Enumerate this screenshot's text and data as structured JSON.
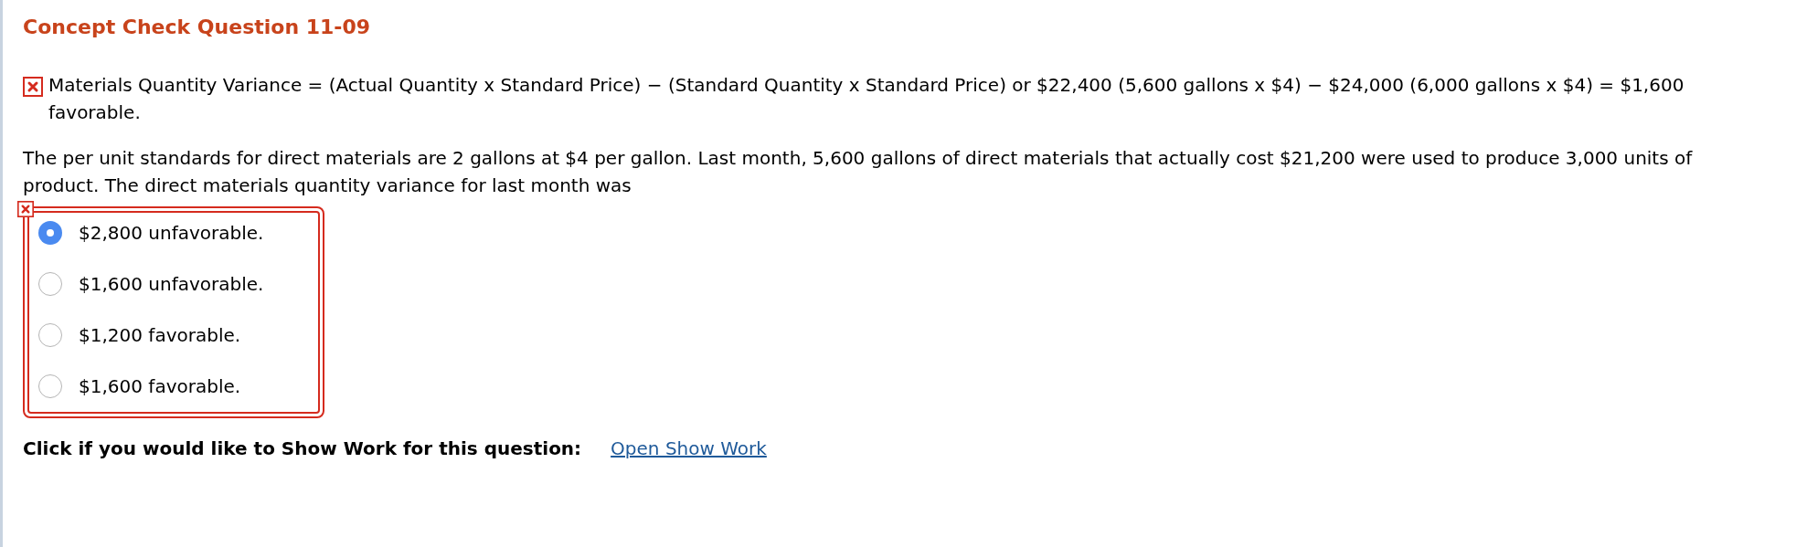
{
  "title": "Concept Check Question 11-09",
  "feedback": {
    "correct": false,
    "text": "Materials Quantity Variance = (Actual Quantity x Standard Price) − (Standard Quantity x Standard Price) or $22,400 (5,600 gallons x $4) − $24,000 (6,000 gallons x $4) = $1,600 favorable."
  },
  "question": "The per unit standards for direct materials are 2 gallons at $4 per gallon. Last month, 5,600 gallons of direct materials that actually cost $21,200 were used to produce 3,000 units of product. The direct materials quantity variance for last month was",
  "answer_correct": false,
  "options": [
    {
      "label": "$2,800 unfavorable.",
      "selected": true
    },
    {
      "label": "$1,600 unfavorable.",
      "selected": false
    },
    {
      "label": "$1,200 favorable.",
      "selected": false
    },
    {
      "label": "$1,600 favorable.",
      "selected": false
    }
  ],
  "show_work": {
    "prompt": "Click if you would like to Show Work for this question:",
    "link": "Open Show Work"
  }
}
